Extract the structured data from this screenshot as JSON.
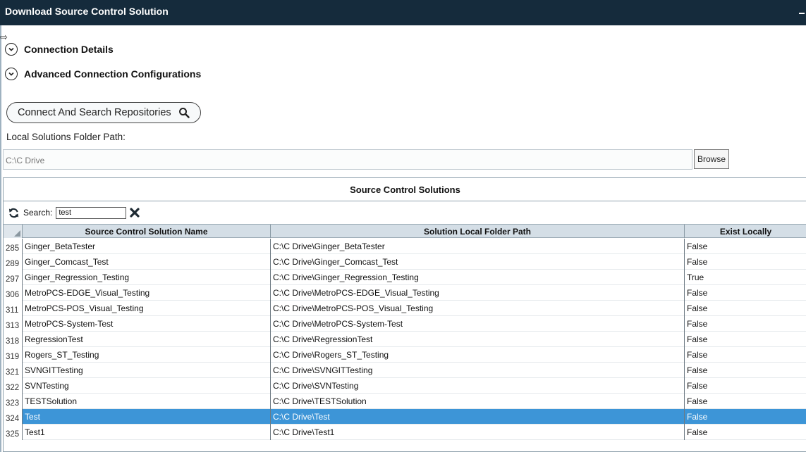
{
  "window": {
    "title": "Download Source Control Solution"
  },
  "expanders": [
    {
      "label": "Connection Details"
    },
    {
      "label": "Advanced Connection Configurations"
    }
  ],
  "connect_button": {
    "label": "Connect And Search Repositories"
  },
  "local_path": {
    "label": "Local Solutions Folder Path:",
    "value": "C:\\C Drive",
    "browse_label": "Browse"
  },
  "panel": {
    "title": "Source Control Solutions"
  },
  "search": {
    "label": "Search:",
    "value": "test"
  },
  "grid": {
    "columns": [
      "Source Control Solution Name",
      "Solution Local Folder Path",
      "Exist Locally"
    ],
    "rows": [
      {
        "num": "285",
        "name": "Ginger_BetaTester",
        "path": "C:\\C Drive\\Ginger_BetaTester",
        "exists": "False"
      },
      {
        "num": "289",
        "name": "Ginger_Comcast_Test",
        "path": "C:\\C Drive\\Ginger_Comcast_Test",
        "exists": "False"
      },
      {
        "num": "297",
        "name": "Ginger_Regression_Testing",
        "path": "C:\\C Drive\\Ginger_Regression_Testing",
        "exists": "True"
      },
      {
        "num": "306",
        "name": "MetroPCS-EDGE_Visual_Testing",
        "path": "C:\\C Drive\\MetroPCS-EDGE_Visual_Testing",
        "exists": "False"
      },
      {
        "num": "311",
        "name": "MetroPCS-POS_Visual_Testing",
        "path": "C:\\C Drive\\MetroPCS-POS_Visual_Testing",
        "exists": "False"
      },
      {
        "num": "313",
        "name": "MetroPCS-System-Test",
        "path": "C:\\C Drive\\MetroPCS-System-Test",
        "exists": "False"
      },
      {
        "num": "318",
        "name": "RegressionTest",
        "path": "C:\\C Drive\\RegressionTest",
        "exists": "False"
      },
      {
        "num": "319",
        "name": "Rogers_ST_Testing",
        "path": "C:\\C Drive\\Rogers_ST_Testing",
        "exists": "False"
      },
      {
        "num": "321",
        "name": "SVNGITTesting",
        "path": "C:\\C Drive\\SVNGITTesting",
        "exists": "False"
      },
      {
        "num": "322",
        "name": "SVNTesting",
        "path": "C:\\C Drive\\SVNTesting",
        "exists": "False"
      },
      {
        "num": "323",
        "name": "TESTSolution",
        "path": "C:\\C Drive\\TESTSolution",
        "exists": "False"
      },
      {
        "num": "324",
        "name": "Test",
        "path": "C:\\C Drive\\Test",
        "exists": "False",
        "selected": true
      },
      {
        "num": "325",
        "name": "Test1",
        "path": "C:\\C Drive\\Test1",
        "exists": "False"
      }
    ]
  },
  "icons": {
    "expander": "chevron-down-icon",
    "connect": "search-icon",
    "refresh": "refresh-icon",
    "clear": "clear-search-icon"
  },
  "colors": {
    "titlebar": "#152b3c",
    "selection": "#3d95d7",
    "header": "#d4dee6"
  }
}
